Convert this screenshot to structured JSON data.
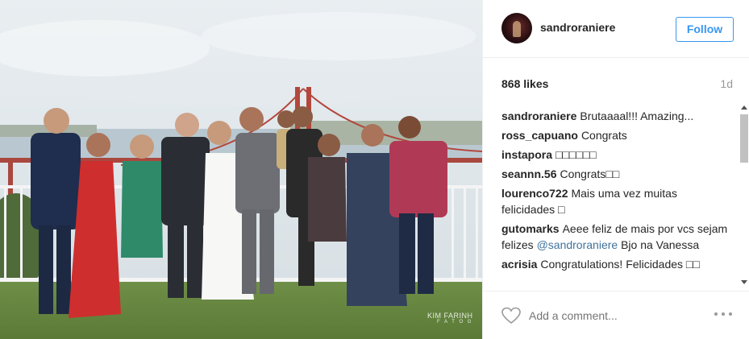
{
  "post": {
    "username": "sandroraniere",
    "follow_label": "Follow",
    "likes": "868 likes",
    "time_ago": "1d",
    "add_comment_placeholder": "Add a comment...",
    "accent_color": "#3897f0",
    "icons": {
      "like": "heart-icon",
      "options": "more-options-icon"
    }
  },
  "photo": {
    "watermark": "KIM FARINH",
    "watermark_sub": "F A T O G"
  },
  "comments": [
    {
      "user": "sandroraniere",
      "text": "Brutaaaal!!! Amazing..."
    },
    {
      "user": "ross_capuano",
      "text": "Congrats"
    },
    {
      "user": "instapora",
      "text": "□□□□□□"
    },
    {
      "user": "seannn.56",
      "text": "Congrats□□"
    },
    {
      "user": "lourenco722",
      "text": "Mais uma vez muitas felicidades □"
    },
    {
      "user": "gutomarks",
      "text": "Aeee feliz de mais por vcs sejam felizes ",
      "mention": "@sandroraniere",
      "text_after": " Bjo na Vanessa"
    },
    {
      "user": "acrisia",
      "text": "Congratulations! Felicidades □□"
    }
  ]
}
